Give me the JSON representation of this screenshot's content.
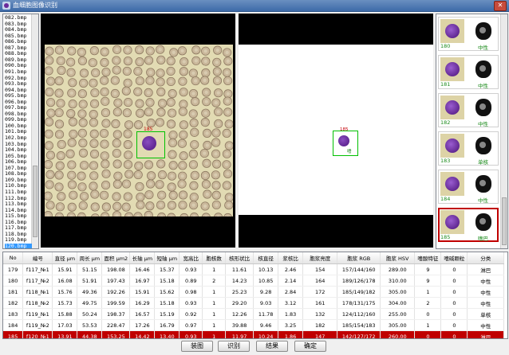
{
  "window": {
    "title": "血细胞图像识别"
  },
  "file_list": {
    "items": [
      "082.bmp",
      "083.bmp",
      "084.bmp",
      "085.bmp",
      "086.bmp",
      "087.bmp",
      "088.bmp",
      "089.bmp",
      "090.bmp",
      "091.bmp",
      "092.bmp",
      "093.bmp",
      "094.bmp",
      "095.bmp",
      "096.bmp",
      "097.bmp",
      "098.bmp",
      "099.bmp",
      "100.bmp",
      "101.bmp",
      "102.bmp",
      "103.bmp",
      "104.bmp",
      "105.bmp",
      "106.bmp",
      "107.bmp",
      "108.bmp",
      "109.bmp",
      "110.bmp",
      "111.bmp",
      "112.bmp",
      "113.bmp",
      "114.bmp",
      "115.bmp",
      "116.bmp",
      "117.bmp",
      "118.bmp",
      "119.bmp",
      "120.bmp"
    ],
    "selected": "120.bmp"
  },
  "left_image": {
    "cell_label": "185"
  },
  "right_image": {
    "cell_label": "185",
    "cell_class": "嗜"
  },
  "thumbnails": [
    {
      "number": "180",
      "class": "中性"
    },
    {
      "number": "181",
      "class": "中性"
    },
    {
      "number": "182",
      "class": "中性"
    },
    {
      "number": "183",
      "class": "单核"
    },
    {
      "number": "184",
      "class": "中性"
    },
    {
      "number": "185",
      "class": "嗜巴"
    }
  ],
  "table": {
    "headers": [
      "No",
      "编号",
      "直径 μm",
      "周长 μm",
      "面积 μm2",
      "长轴 μm",
      "短轴 μm",
      "宽高比",
      "胞核数",
      "核形状比",
      "核直径",
      "浆核比",
      "胞浆亮度",
      "胞浆 RGB",
      "胞浆 HSV",
      "嗜酸特征",
      "嗜碱颗粒",
      "分类"
    ],
    "rows": [
      [
        "179",
        "f117_№1",
        "15.91",
        "51.15",
        "198.08",
        "16.46",
        "15.37",
        "0.93",
        "1",
        "11.61",
        "10.13",
        "2.46",
        "154",
        "157/144/160",
        "289.00",
        "9",
        "0",
        "淋巴"
      ],
      [
        "180",
        "f117_№2",
        "16.08",
        "51.91",
        "197.43",
        "16.97",
        "15.18",
        "0.89",
        "2",
        "14.23",
        "10.85",
        "2.14",
        "164",
        "189/126/178",
        "310.00",
        "9",
        "0",
        "中性"
      ],
      [
        "181",
        "f118_№1",
        "15.76",
        "49.36",
        "192.26",
        "15.91",
        "15.62",
        "0.98",
        "1",
        "25.23",
        "9.28",
        "2.84",
        "172",
        "185/149/182",
        "305.00",
        "1",
        "0",
        "中性"
      ],
      [
        "182",
        "f118_№2",
        "15.73",
        "49.75",
        "199.59",
        "16.29",
        "15.18",
        "0.93",
        "1",
        "29.20",
        "9.03",
        "3.12",
        "161",
        "178/131/175",
        "304.00",
        "2",
        "0",
        "中性"
      ],
      [
        "183",
        "f119_№1",
        "15.88",
        "50.24",
        "198.37",
        "16.57",
        "15.19",
        "0.92",
        "1",
        "12.26",
        "11.78",
        "1.83",
        "132",
        "124/112/160",
        "255.00",
        "0",
        "0",
        "单核"
      ],
      [
        "184",
        "f119_№2",
        "17.03",
        "53.53",
        "228.47",
        "17.26",
        "16.79",
        "0.97",
        "1",
        "39.88",
        "9.46",
        "3.25",
        "182",
        "185/154/183",
        "305.00",
        "1",
        "0",
        "中性"
      ],
      [
        "185",
        "f120_№1",
        "13.91",
        "44.38",
        "153.25",
        "14.42",
        "13.40",
        "0.93",
        "1",
        "11.97",
        "10.24",
        "1.86",
        "147",
        "142/127/172",
        "260.00",
        "0",
        "0",
        "淋巴"
      ]
    ],
    "selected_index": 6
  },
  "buttons": {
    "load": "装图",
    "recognize": "识别",
    "result": "结果",
    "ok": "确定"
  }
}
